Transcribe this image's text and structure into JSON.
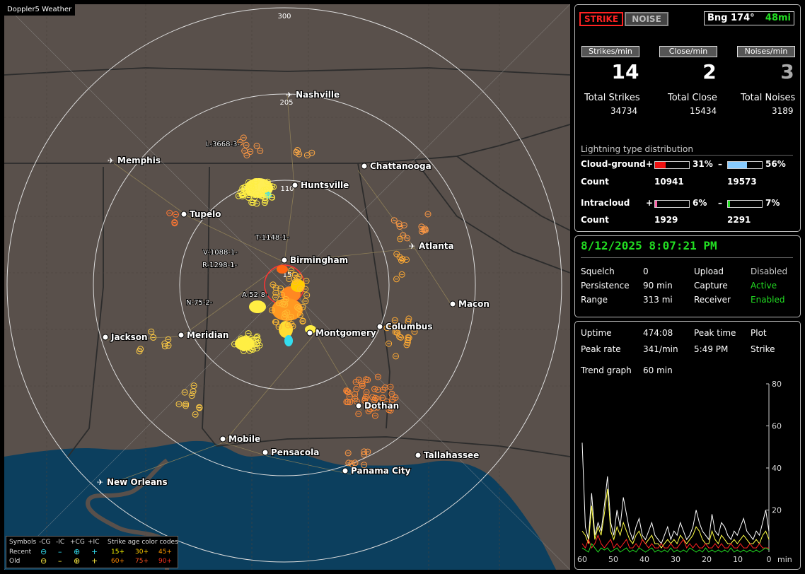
{
  "map": {
    "title": "Doppler5 Weather",
    "range_labels": [
      "300",
      "205",
      "110",
      "15"
    ],
    "cities": [
      {
        "name": "Nashville",
        "type": "airport"
      },
      {
        "name": "Memphis",
        "type": "airport"
      },
      {
        "name": "Chattanooga",
        "type": "city"
      },
      {
        "name": "Huntsville",
        "type": "city"
      },
      {
        "name": "Tupelo",
        "type": "city"
      },
      {
        "name": "Atlanta",
        "type": "airport"
      },
      {
        "name": "Birmingham",
        "type": "city"
      },
      {
        "name": "Macon",
        "type": "city"
      },
      {
        "name": "Columbus",
        "type": "city"
      },
      {
        "name": "Jackson",
        "type": "city"
      },
      {
        "name": "Meridian",
        "type": "city"
      },
      {
        "name": "Montgomery",
        "type": "city"
      },
      {
        "name": "Dothan",
        "type": "city"
      },
      {
        "name": "Mobile",
        "type": "city"
      },
      {
        "name": "Pensacola",
        "type": "city"
      },
      {
        "name": "Tallahassee",
        "type": "city"
      },
      {
        "name": "Panama City",
        "type": "city"
      },
      {
        "name": "New Orleans",
        "type": "airport"
      }
    ],
    "storm_tags": [
      "L-3668-3-",
      "T-1148-1-",
      "V-1088-1-",
      "R-1298-1-",
      "A-52-8-",
      "N-75-2-"
    ],
    "legend": {
      "symbols_label": "Symbols",
      "cols": [
        "-CG",
        "-IC",
        "+CG",
        "+IC"
      ],
      "recent_label": "Recent",
      "old_label": "Old",
      "age_title": "Strike age color codes",
      "ages_recent": [
        "15+",
        "30+",
        "45+"
      ],
      "ages_old": [
        "60+",
        "75+",
        "90+"
      ],
      "age_colors": [
        "#ffff00",
        "#ffcc00",
        "#ff9900",
        "#ff7700",
        "#ff4400",
        "#ff2200"
      ]
    }
  },
  "status": {
    "strike_label": "STRIKE",
    "noise_label": "NOISE",
    "bearing": "Bng 174°",
    "distance": "48mi"
  },
  "counters": {
    "strikes_hdr": "Strikes/min",
    "close_hdr": "Close/min",
    "noises_hdr": "Noises/min",
    "strikes": "14",
    "close": "2",
    "noises": "3",
    "total_strikes_label": "Total Strikes",
    "total_close_label": "Total Close",
    "total_noises_label": "Total Noises",
    "total_strikes": "34734",
    "total_close": "15434",
    "total_noises": "3189"
  },
  "distribution": {
    "title": "Lightning type distribution",
    "cg_label": "Cloud-ground",
    "ic_label": "Intracloud",
    "count_label": "Count",
    "plus": "+",
    "minus": "–",
    "cg_pos_pct": "31%",
    "cg_neg_pct": "56%",
    "ic_pos_pct": "6%",
    "ic_neg_pct": "7%",
    "cg_pos_count": "10941",
    "cg_neg_count": "19573",
    "ic_pos_count": "1929",
    "ic_neg_count": "2291",
    "cg_pos_frac": 0.31,
    "cg_neg_frac": 0.56,
    "ic_pos_frac": 0.06,
    "ic_neg_frac": 0.07,
    "colors": {
      "cg_pos": "#ee1111",
      "cg_neg": "#88ccff",
      "ic_pos": "#ff66aa",
      "ic_neg": "#22dd22"
    }
  },
  "datetime": "8/12/2025 8:07:21 PM",
  "settings": {
    "squelch_label": "Squelch",
    "squelch": "0",
    "persistence_label": "Persistence",
    "persistence": "90 min",
    "range_label": "Range",
    "range": "313 mi",
    "upload_label": "Upload",
    "upload": "Disabled",
    "capture_label": "Capture",
    "capture": "Active",
    "receiver_label": "Receiver",
    "receiver": "Enabled"
  },
  "stats": {
    "uptime_label": "Uptime",
    "uptime": "474:08",
    "peak_time_label": "Peak time",
    "peak_time": "5:49 PM",
    "plot_label": "Plot",
    "plot": "Strike",
    "peak_rate_label": "Peak rate",
    "peak_rate": "341/min",
    "trend_label": "Trend graph",
    "trend": "60 min"
  },
  "chart_data": {
    "type": "line",
    "xlabel": "min",
    "x_ticks": [
      "60",
      "50",
      "40",
      "30",
      "20",
      "10",
      "0"
    ],
    "y_ticks": [
      "80",
      "60",
      "40",
      "20"
    ],
    "ylim": [
      0,
      80
    ],
    "xlim": [
      60,
      0
    ],
    "series": [
      {
        "color": "#ffffff",
        "values": [
          52,
          12,
          6,
          28,
          8,
          14,
          10,
          22,
          36,
          14,
          8,
          20,
          12,
          26,
          18,
          10,
          6,
          12,
          16,
          8,
          6,
          10,
          14,
          8,
          6,
          4,
          8,
          12,
          6,
          10,
          8,
          14,
          10,
          6,
          8,
          12,
          20,
          14,
          10,
          8,
          6,
          18,
          10,
          8,
          14,
          12,
          8,
          6,
          10,
          8,
          12,
          16,
          10,
          8,
          6,
          10,
          8,
          14,
          20,
          10
        ]
      },
      {
        "color": "#ffff44",
        "values": [
          10,
          8,
          4,
          22,
          6,
          12,
          8,
          18,
          30,
          10,
          6,
          12,
          8,
          14,
          10,
          6,
          4,
          8,
          10,
          6,
          4,
          6,
          8,
          4,
          4,
          2,
          4,
          6,
          4,
          6,
          4,
          8,
          6,
          4,
          6,
          8,
          12,
          10,
          6,
          4,
          4,
          10,
          6,
          4,
          8,
          6,
          4,
          4,
          6,
          4,
          6,
          8,
          6,
          4,
          4,
          6,
          4,
          8,
          10,
          6
        ]
      },
      {
        "color": "#ff2222",
        "values": [
          4,
          2,
          6,
          2,
          4,
          8,
          4,
          2,
          4,
          6,
          2,
          4,
          2,
          4,
          6,
          2,
          2,
          4,
          2,
          6,
          4,
          2,
          4,
          2,
          2,
          4,
          2,
          2,
          4,
          2,
          2,
          4,
          6,
          2,
          4,
          2,
          4,
          2,
          2,
          4,
          2,
          2,
          4,
          2,
          4,
          2,
          2,
          4,
          2,
          2,
          4,
          2,
          2,
          4,
          2,
          2,
          4,
          2,
          2,
          2
        ]
      },
      {
        "color": "#22dd22",
        "values": [
          2,
          1,
          0,
          4,
          2,
          0,
          2,
          1,
          2,
          0,
          1,
          2,
          0,
          1,
          2,
          0,
          1,
          0,
          2,
          1,
          0,
          1,
          2,
          0,
          1,
          0,
          1,
          0,
          2,
          0,
          1,
          0,
          1,
          0,
          2,
          1,
          0,
          1,
          0,
          2,
          0,
          1,
          0,
          1,
          0,
          1,
          0,
          2,
          0,
          1,
          0,
          1,
          0,
          1,
          0,
          1,
          0,
          1,
          2,
          1
        ]
      }
    ]
  }
}
